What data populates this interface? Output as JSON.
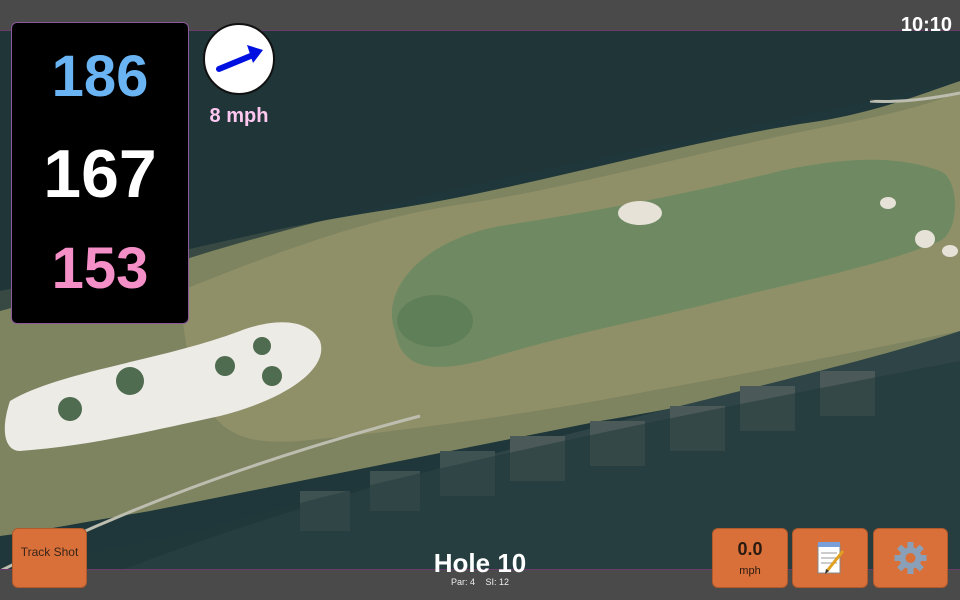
{
  "status": {
    "clock": "10:10"
  },
  "distances": {
    "back": "186",
    "middle": "167",
    "front": "153"
  },
  "wind": {
    "speed": "8 mph",
    "icon": "wind-direction-arrow-icon",
    "arrow_color": "#0010e0"
  },
  "hole": {
    "title": "Hole 10",
    "par": "Par: 4",
    "stroke_index": "SI: 12"
  },
  "buttons": {
    "track_shot": "Track Shot",
    "speed_value": "0.0",
    "speed_unit": "mph",
    "notes_icon": "notepad-icon",
    "settings_icon": "gear-icon"
  },
  "colors": {
    "accent_button": "#d9703a",
    "back_distance": "#6ab4f4",
    "middle_distance": "#ffffff",
    "front_distance": "#f48fc8",
    "wind_text": "#ffc8f0"
  }
}
